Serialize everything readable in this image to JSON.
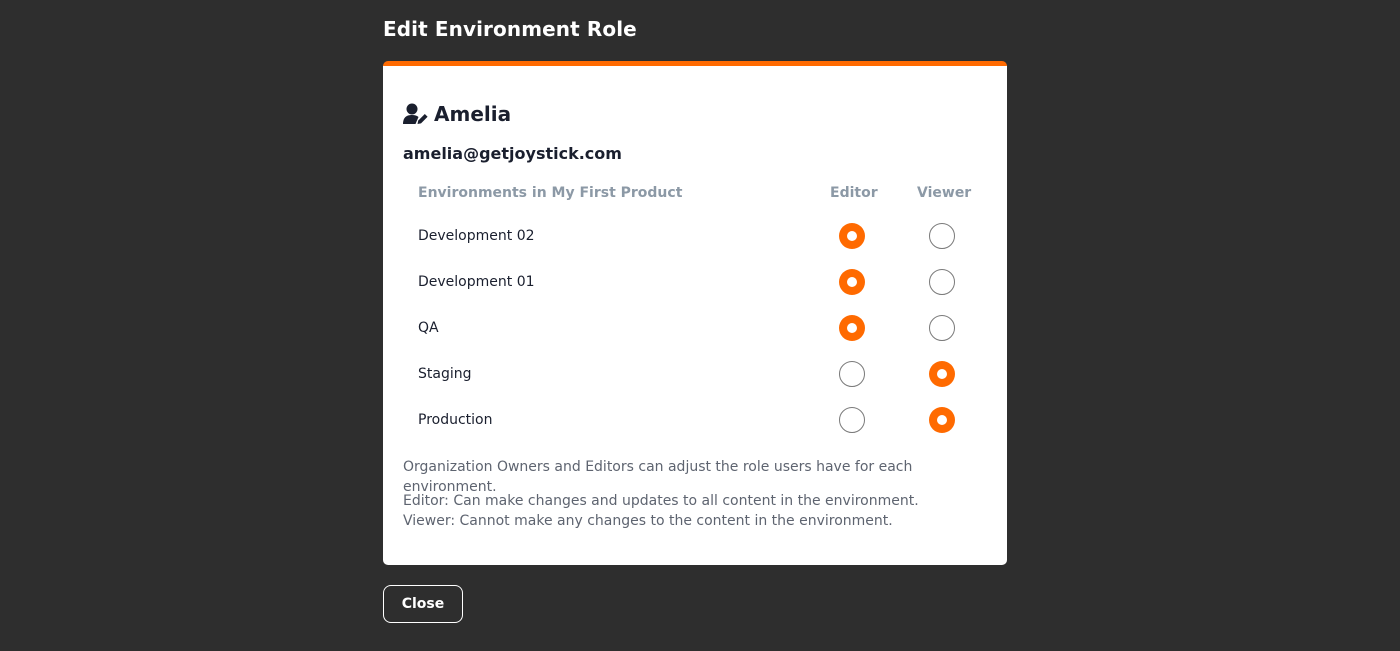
{
  "page": {
    "title": "Edit Environment Role"
  },
  "user": {
    "name": "Amelia",
    "email": "amelia@getjoystick.com",
    "icon": "user-edit-icon"
  },
  "table": {
    "header_environment": "Environments in My First Product",
    "header_editor": "Editor",
    "header_viewer": "Viewer",
    "rows": [
      {
        "name": "Development 02",
        "role": "Editor"
      },
      {
        "name": "Development 01",
        "role": "Editor"
      },
      {
        "name": "QA",
        "role": "Editor"
      },
      {
        "name": "Staging",
        "role": "Viewer"
      },
      {
        "name": "Production",
        "role": "Viewer"
      }
    ]
  },
  "notes": {
    "permission_note": "Organization Owners and Editors can adjust the role users have for each environment.",
    "editor_desc": "Editor: Can make changes and updates to all content in the environment.",
    "viewer_desc": "Viewer: Cannot make any changes to the content in the environment."
  },
  "footer": {
    "close_label": "Close"
  },
  "colors": {
    "accent": "#ff6a00",
    "background": "#2e2e2e",
    "card": "#ffffff",
    "header_text": "#8c99a6"
  }
}
